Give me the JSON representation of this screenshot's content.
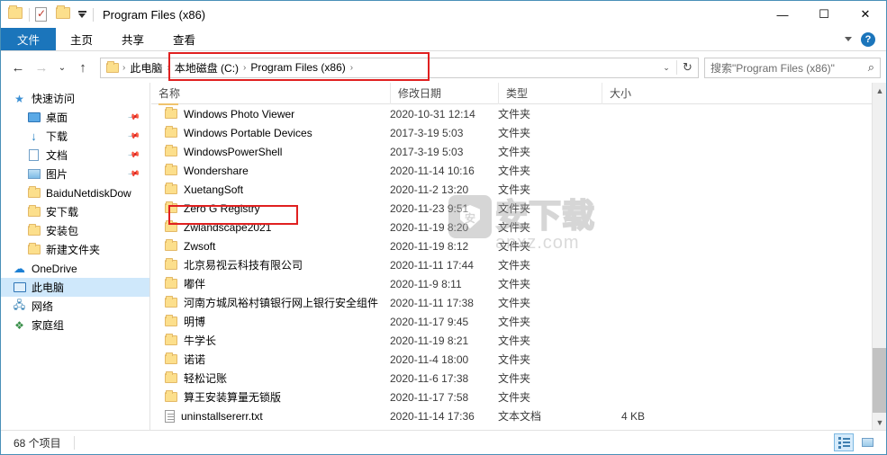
{
  "window": {
    "title": "Program Files (x86)",
    "quick_access_toolbar": [
      {
        "name": "folder-icon",
        "label": "属性"
      },
      {
        "name": "properties-icon",
        "label": "属性"
      },
      {
        "name": "new-folder-icon",
        "label": "新建文件夹"
      }
    ],
    "controls": {
      "minimize": "—",
      "maximize": "☐",
      "close": "✕"
    }
  },
  "ribbon": {
    "tabs": [
      {
        "label": "文件",
        "active": true
      },
      {
        "label": "主页",
        "active": false
      },
      {
        "label": "共享",
        "active": false
      },
      {
        "label": "查看",
        "active": false
      }
    ],
    "collapse_icon": "chevron-down-icon",
    "help_label": "?"
  },
  "nav": {
    "back": "←",
    "forward": "→",
    "recent": "⌄",
    "up": "↑",
    "refresh": "↻",
    "dropdown": "⌄"
  },
  "address": {
    "crumbs": [
      "此电脑",
      "本地磁盘 (C:)",
      "Program Files (x86)"
    ],
    "separator": "›"
  },
  "search": {
    "placeholder": "搜索\"Program Files (x86)\"",
    "value": "搜索\"Program Files (x86)\"",
    "icon": "search-icon"
  },
  "sidebar": {
    "items": [
      {
        "label": "快速访问",
        "icon": "star-icon",
        "indent": false,
        "pinned": false,
        "selected": false
      },
      {
        "label": "桌面",
        "icon": "desktop-icon",
        "indent": true,
        "pinned": true,
        "selected": false
      },
      {
        "label": "下载",
        "icon": "download-icon",
        "indent": true,
        "pinned": true,
        "selected": false
      },
      {
        "label": "文档",
        "icon": "document-icon",
        "indent": true,
        "pinned": true,
        "selected": false
      },
      {
        "label": "图片",
        "icon": "pictures-icon",
        "indent": true,
        "pinned": true,
        "selected": false
      },
      {
        "label": "BaiduNetdiskDow",
        "icon": "folder-icon",
        "indent": true,
        "pinned": false,
        "selected": false
      },
      {
        "label": "安下载",
        "icon": "folder-icon",
        "indent": true,
        "pinned": false,
        "selected": false
      },
      {
        "label": "安装包",
        "icon": "folder-icon",
        "indent": true,
        "pinned": false,
        "selected": false
      },
      {
        "label": "新建文件夹",
        "icon": "folder-icon",
        "indent": true,
        "pinned": false,
        "selected": false
      },
      {
        "label": "OneDrive",
        "icon": "cloud-icon",
        "indent": false,
        "pinned": false,
        "selected": false
      },
      {
        "label": "此电脑",
        "icon": "computer-icon",
        "indent": false,
        "pinned": false,
        "selected": true
      },
      {
        "label": "网络",
        "icon": "network-icon",
        "indent": false,
        "pinned": false,
        "selected": false
      },
      {
        "label": "家庭组",
        "icon": "homegroup-icon",
        "indent": false,
        "pinned": false,
        "selected": false
      }
    ]
  },
  "file_list": {
    "columns": [
      {
        "label": "名称",
        "key": "name"
      },
      {
        "label": "修改日期",
        "key": "date"
      },
      {
        "label": "类型",
        "key": "type"
      },
      {
        "label": "大小",
        "key": "size"
      }
    ],
    "sort_column": "名称",
    "sort_direction": "asc",
    "rows": [
      {
        "name": "Windows Photo Viewer",
        "date": "2020-10-31 12:14",
        "type": "文件夹",
        "size": "",
        "icon": "folder-icon",
        "highlighted": false
      },
      {
        "name": "Windows Portable Devices",
        "date": "2017-3-19 5:03",
        "type": "文件夹",
        "size": "",
        "icon": "folder-icon",
        "highlighted": false
      },
      {
        "name": "WindowsPowerShell",
        "date": "2017-3-19 5:03",
        "type": "文件夹",
        "size": "",
        "icon": "folder-icon",
        "highlighted": false
      },
      {
        "name": "Wondershare",
        "date": "2020-11-14 10:16",
        "type": "文件夹",
        "size": "",
        "icon": "folder-icon",
        "highlighted": false
      },
      {
        "name": "XuetangSoft",
        "date": "2020-11-2 13:20",
        "type": "文件夹",
        "size": "",
        "icon": "folder-icon",
        "highlighted": false
      },
      {
        "name": "Zero G Registry",
        "date": "2020-11-23 9:51",
        "type": "文件夹",
        "size": "",
        "icon": "folder-icon",
        "highlighted": true
      },
      {
        "name": "Zwlandscape2021",
        "date": "2020-11-19 8:20",
        "type": "文件夹",
        "size": "",
        "icon": "folder-icon",
        "highlighted": false
      },
      {
        "name": "Zwsoft",
        "date": "2020-11-19 8:12",
        "type": "文件夹",
        "size": "",
        "icon": "folder-icon",
        "highlighted": false
      },
      {
        "name": "北京易视云科技有限公司",
        "date": "2020-11-11 17:44",
        "type": "文件夹",
        "size": "",
        "icon": "folder-icon",
        "highlighted": false
      },
      {
        "name": "嘟伴",
        "date": "2020-11-9 8:11",
        "type": "文件夹",
        "size": "",
        "icon": "folder-icon",
        "highlighted": false
      },
      {
        "name": "河南方城凤裕村镇银行网上银行安全组件",
        "date": "2020-11-11 17:38",
        "type": "文件夹",
        "size": "",
        "icon": "folder-icon",
        "highlighted": false
      },
      {
        "name": "明博",
        "date": "2020-11-17 9:45",
        "type": "文件夹",
        "size": "",
        "icon": "folder-icon",
        "highlighted": false
      },
      {
        "name": "牛学长",
        "date": "2020-11-19 8:21",
        "type": "文件夹",
        "size": "",
        "icon": "folder-icon",
        "highlighted": false
      },
      {
        "name": "诺诺",
        "date": "2020-11-4 18:00",
        "type": "文件夹",
        "size": "",
        "icon": "folder-icon",
        "highlighted": false
      },
      {
        "name": "轻松记账",
        "date": "2020-11-6 17:38",
        "type": "文件夹",
        "size": "",
        "icon": "folder-icon",
        "highlighted": false
      },
      {
        "name": "算王安装算量无锁版",
        "date": "2020-11-17 7:58",
        "type": "文件夹",
        "size": "",
        "icon": "folder-icon",
        "highlighted": false
      },
      {
        "name": "uninstallsererr.txt",
        "date": "2020-11-14 17:36",
        "type": "文本文档",
        "size": "4 KB",
        "icon": "text-file-icon",
        "highlighted": false
      }
    ]
  },
  "watermark": {
    "text_cn": "安下载",
    "url": "anxz.com",
    "badge_char": "安"
  },
  "statusbar": {
    "item_count": "68 个项目",
    "view_details": "details-view-icon",
    "view_thumbnails": "thumbnail-view-icon"
  },
  "colors": {
    "accent": "#1b75bb",
    "selection": "#cfe8fb",
    "annotation": "#e02020",
    "folder": "#fcdf8c"
  }
}
